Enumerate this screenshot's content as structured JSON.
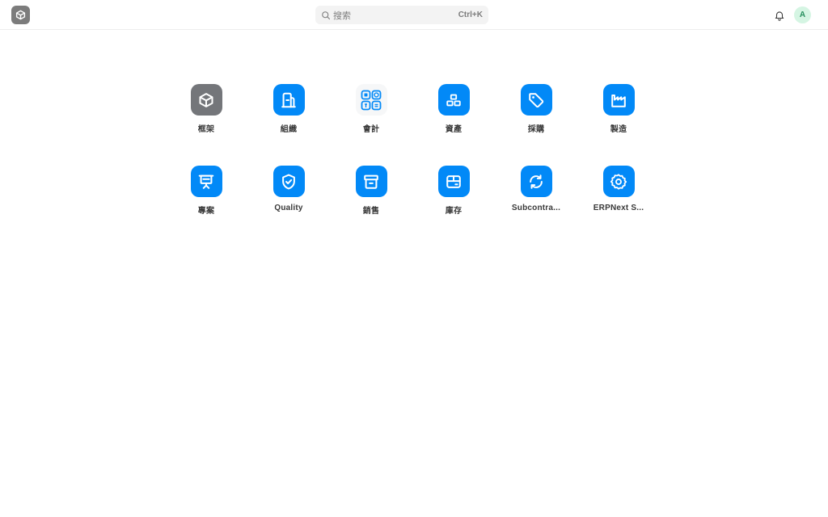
{
  "navbar": {
    "logo_icon": "cube-icon",
    "search": {
      "placeholder": "搜索",
      "shortcut": "Ctrl+K"
    },
    "notification_icon": "bell-icon",
    "avatar_initial": "A"
  },
  "apps": [
    {
      "label": "框架",
      "icon": "cube-icon"
    },
    {
      "label": "組織",
      "icon": "building-icon"
    },
    {
      "label": "會計",
      "icon": "accounting-grid-icon"
    },
    {
      "label": "資產",
      "icon": "assets-stack-icon"
    },
    {
      "label": "採購",
      "icon": "tag-icon"
    },
    {
      "label": "製造",
      "icon": "factory-icon"
    },
    {
      "label": "專案",
      "icon": "presentation-board-icon"
    },
    {
      "label": "Quality",
      "icon": "shield-check-icon"
    },
    {
      "label": "銷售",
      "icon": "archive-box-icon"
    },
    {
      "label": "庫存",
      "icon": "package-icon"
    },
    {
      "label": "Subcontra...",
      "icon": "refresh-cycle-icon"
    },
    {
      "label": "ERPNext S...",
      "icon": "gear-icon"
    }
  ],
  "colors": {
    "app_blue": "#0289f7",
    "framework_gray": "#74767a",
    "avatar_bg": "#d5f5e3",
    "avatar_text": "#278f5e"
  }
}
